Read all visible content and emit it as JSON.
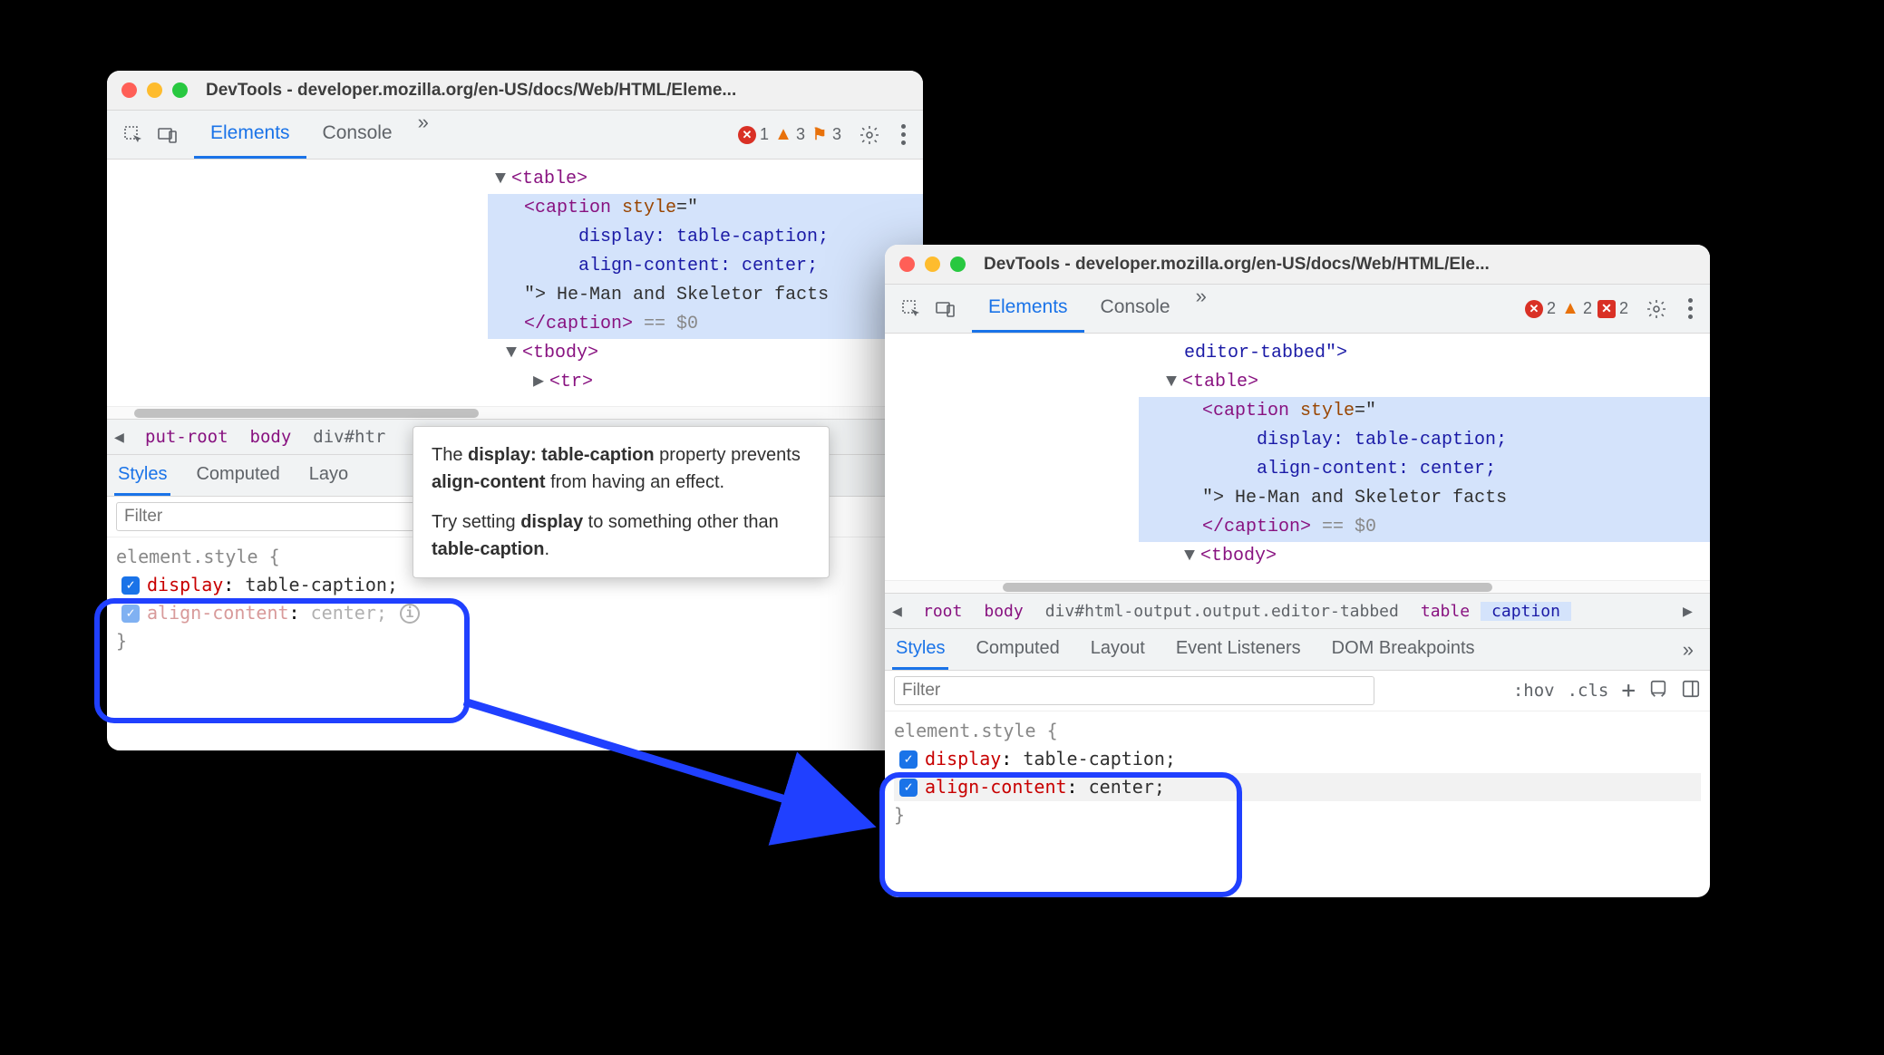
{
  "windows": {
    "a": {
      "title": "DevTools - developer.mozilla.org/en-US/docs/Web/HTML/Eleme...",
      "tabs": {
        "elements": "Elements",
        "console": "Console"
      },
      "badges": {
        "errors": "1",
        "warnings": "3",
        "flags": "3"
      },
      "dom": {
        "table": "<table>",
        "caption_open": "<caption",
        "style_attr": "style",
        "eq": "=\"",
        "display_prop": "display",
        "display_val": "table-caption",
        "align_prop": "align-content",
        "align_val": "center",
        "close_quote": "\">",
        "text": "He-Man and Skeletor facts",
        "caption_close": "</caption>",
        "eqdollar": "== $0",
        "tbody": "<tbody>",
        "tr": "<tr>"
      },
      "crumbs": {
        "root": "put-root",
        "body": "body",
        "div": "div#htr"
      },
      "subtabs": {
        "styles": "Styles",
        "computed": "Computed",
        "layout": "Layo"
      },
      "filter_placeholder": "Filter",
      "rule": {
        "selector_open": "element.style {",
        "p1_name": "display",
        "p1_val": "table-caption;",
        "p2_name": "align-content",
        "p2_val": "center;",
        "close": "}"
      }
    },
    "b": {
      "title": "DevTools - developer.mozilla.org/en-US/docs/Web/HTML/Ele...",
      "tabs": {
        "elements": "Elements",
        "console": "Console"
      },
      "badges": {
        "errors": "2",
        "warnings": "2",
        "flags": "2"
      },
      "dom": {
        "editor_tabbed": "editor-tabbed\">",
        "table": "<table>",
        "caption_open": "<caption",
        "style_attr": "style",
        "eq": "=\"",
        "display_prop": "display",
        "display_val": "table-caption",
        "align_prop": "align-content",
        "align_val": "center",
        "close_quote": "\">",
        "text": "He-Man and Skeletor facts",
        "caption_close": "</caption>",
        "eqdollar": "== $0",
        "tbody": "<tbody>"
      },
      "crumbs": {
        "root": "root",
        "body": "body",
        "div": "div#html-output.output.editor-tabbed",
        "table": "table",
        "caption": "caption"
      },
      "subtabs": {
        "styles": "Styles",
        "computed": "Computed",
        "layout": "Layout",
        "listeners": "Event Listeners",
        "dombp": "DOM Breakpoints"
      },
      "filter_placeholder": "Filter",
      "filter_tools": {
        "hov": ":hov",
        "cls": ".cls"
      },
      "rule": {
        "selector_open": "element.style {",
        "p1_name": "display",
        "p1_val": "table-caption;",
        "p2_name": "align-content",
        "p2_val": "center;",
        "close": "}"
      }
    }
  },
  "tooltip": {
    "l1a": "The ",
    "l1b": "display: table-caption",
    "l1c": " property prevents ",
    "l1d": "align-content",
    "l1e": " from having an effect.",
    "l2a": "Try setting ",
    "l2b": "display",
    "l2c": " to something other than ",
    "l2d": "table-caption",
    "l2e": "."
  }
}
